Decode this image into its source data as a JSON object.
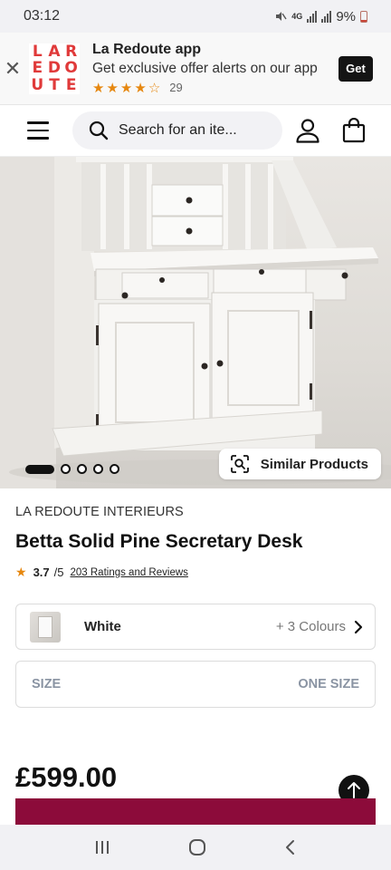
{
  "status_bar": {
    "time": "03:12",
    "network": "4G",
    "battery": "9%"
  },
  "app_banner": {
    "logo_letters": [
      "L",
      "A",
      "R",
      "E",
      "D",
      "O",
      "U",
      "T",
      "E"
    ],
    "title": "La Redoute app",
    "subtitle": "Get exclusive offer alerts on our app",
    "rating_stars": 4.5,
    "rating_count": "29",
    "get_label": "Get",
    "accent_color": "#e03a3a"
  },
  "header": {
    "search_placeholder": "Search for an ite..."
  },
  "gallery": {
    "image_count": 5,
    "active_index": 0,
    "similar_label": "Similar Products"
  },
  "product": {
    "brand": "LA REDOUTE INTERIEURS",
    "title": "Betta Solid Pine Secretary Desk",
    "rating_value": "3.7",
    "rating_out_of": "/5",
    "reviews_link": "203 Ratings and Reviews",
    "colour_name": "White",
    "more_colours": "+ 3 Colours",
    "size_label": "SIZE",
    "size_value": "ONE SIZE",
    "price": "£599.00",
    "cta_color": "#8c0b3a"
  }
}
